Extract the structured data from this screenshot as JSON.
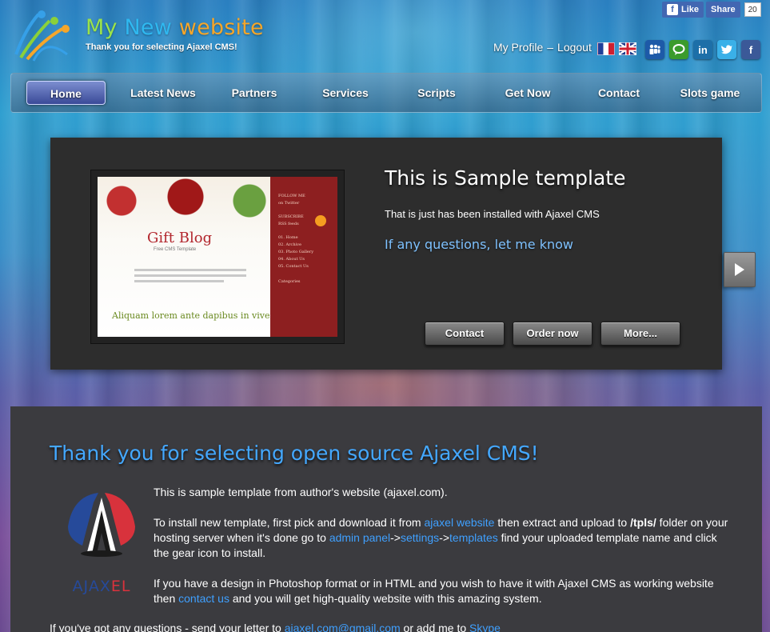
{
  "header": {
    "title_words": [
      "My",
      "New",
      "website"
    ],
    "subtitle": "Thank you for selecting Ajaxel CMS!",
    "fb_like": "Like",
    "fb_share": "Share",
    "fb_count": "20",
    "my_profile": "My Profile",
    "separator": "–",
    "logout": "Logout"
  },
  "nav": {
    "items": [
      "Home",
      "Latest News",
      "Partners",
      "Services",
      "Scripts",
      "Get Now",
      "Contact",
      "Slots game"
    ]
  },
  "slider": {
    "title": "This is Sample template",
    "text": "That is just has been installed with Ajaxel CMS",
    "link": "If any questions, let me know",
    "buttons": [
      "Contact",
      "Order now",
      "More..."
    ],
    "preview": {
      "title": "Gift Blog",
      "subtitle": "Free CMS Template",
      "heading": "Aliquam lorem ante dapibus in viverra",
      "sidebar": [
        "FOLLOW ME",
        "on Twitter",
        "SUBSCRIBE",
        "RSS feeds",
        "01. Home",
        "02. Archive",
        "03. Photo Gallery",
        "04. About Us",
        "05. Contact Us",
        "Categories"
      ]
    }
  },
  "content": {
    "title": "Thank you for selecting open source Ajaxel CMS!",
    "logo_text_1": "AJAX",
    "logo_text_2": "EL",
    "p1": "This is sample template from author's website (ajaxel.com).",
    "p2_a": "To install new template, first pick and download it from ",
    "p2_link1": "ajaxel website",
    "p2_b": " then extract and upload to ",
    "p2_bold": "/tpls/",
    "p2_c": " folder on your hosting server when it's done go to ",
    "p2_link2": "admin panel",
    "p2_arrow1": "->",
    "p2_link3": "settings",
    "p2_arrow2": "->",
    "p2_link4": "templates",
    "p2_d": " find your uploaded template name and click the gear icon to install.",
    "p3_a": "If you have a design in Photoshop format or in HTML and you wish to have it with Ajaxel CMS as working website then ",
    "p3_link": "contact us",
    "p3_b": " and you will get high-quality website with this amazing system.",
    "bottom_a": "If you've got any questions - send your letter to ",
    "bottom_link1": "ajaxel.com@gmail.com",
    "bottom_b": " or add me to ",
    "bottom_link2": "Skype"
  },
  "colors": {
    "title_green": "#9be34a",
    "title_blue": "#2fb8f0",
    "title_orange": "#f5a62a",
    "link_blue": "#3fa0ff"
  },
  "icons": [
    "ajaxel-logo-icon",
    "flag-fr-icon",
    "flag-uk-icon",
    "myspace-icon",
    "talk-icon",
    "linkedin-icon",
    "twitter-icon",
    "facebook-icon",
    "next-arrow-icon"
  ]
}
